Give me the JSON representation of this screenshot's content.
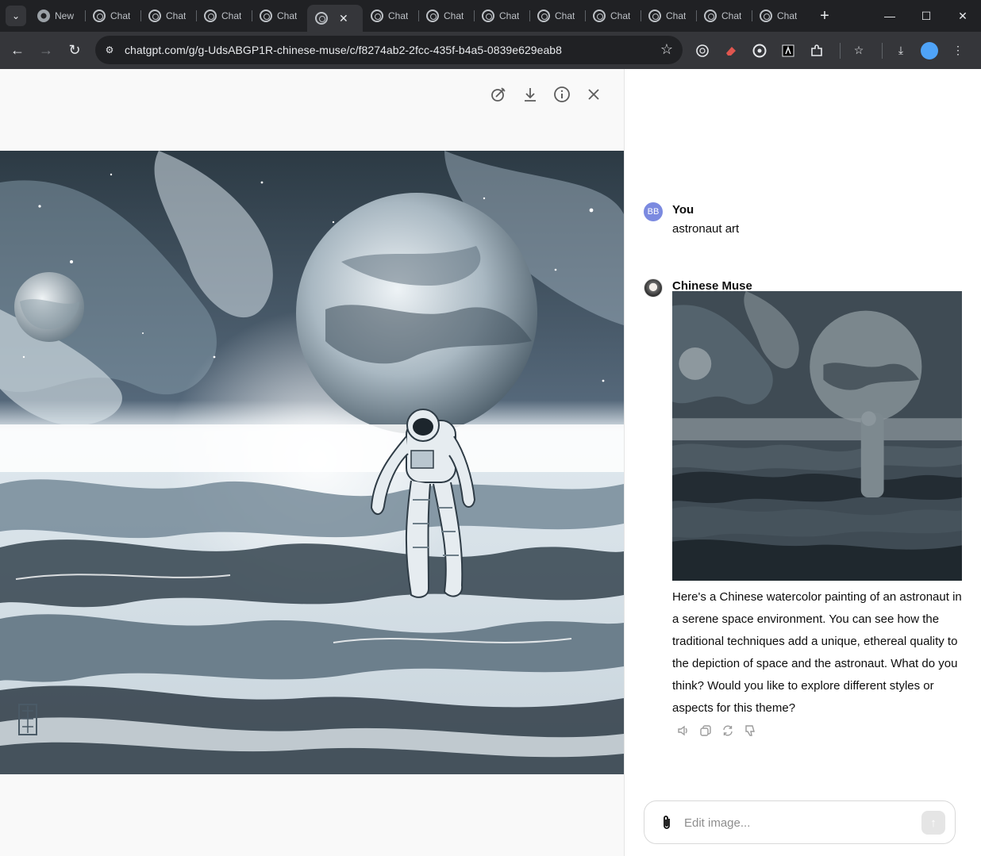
{
  "browser": {
    "tabs": [
      {
        "label": "New",
        "favicon": "chrome-icon",
        "active": false
      },
      {
        "label": "Chat",
        "favicon": "chatgpt-icon",
        "active": false
      },
      {
        "label": "Chat",
        "favicon": "chatgpt-icon",
        "active": false
      },
      {
        "label": "Chat",
        "favicon": "chatgpt-icon",
        "active": false
      },
      {
        "label": "Chat",
        "favicon": "chatgpt-icon",
        "active": false
      },
      {
        "label": "",
        "favicon": "chatgpt-icon",
        "active": true
      },
      {
        "label": "Chat",
        "favicon": "chatgpt-icon",
        "active": false
      },
      {
        "label": "Chat",
        "favicon": "chatgpt-icon",
        "active": false
      },
      {
        "label": "Chat",
        "favicon": "chatgpt-icon",
        "active": false
      },
      {
        "label": "Chat",
        "favicon": "chatgpt-icon",
        "active": false
      },
      {
        "label": "Chat",
        "favicon": "chatgpt-icon",
        "active": false
      },
      {
        "label": "Chat",
        "favicon": "chatgpt-icon",
        "active": false
      },
      {
        "label": "Chat",
        "favicon": "chatgpt-icon",
        "active": false
      },
      {
        "label": "Chat",
        "favicon": "chatgpt-icon",
        "active": false
      }
    ],
    "url": "chatgpt.com/g/g-UdsABGP1R-chinese-muse/c/f8274ab2-2fcc-435f-b4a5-0839e629eab8"
  },
  "viewer": {
    "tools": [
      "edit-selection-icon",
      "download-icon",
      "info-icon",
      "close-icon"
    ]
  },
  "chat": {
    "user": {
      "initials": "BB",
      "name": "You",
      "message": "astronaut art"
    },
    "assistant": {
      "name": "Chinese Muse",
      "reply": "Here's a Chinese watercolor painting of an astronaut in a serene space environment. You can see how the traditional techniques add a unique, ethereal quality to the depiction of space and the astronaut. What do you think? Would you like to explore different styles or aspects for this theme?"
    },
    "composer": {
      "placeholder": "Edit image..."
    }
  },
  "colors": {
    "chrome_dark": "#202124",
    "chrome_toolbar": "#35363a",
    "viewer_bg": "#f9f9f9",
    "user_avatar": "#7b8ae0",
    "ink_dark": "#2e3b45",
    "ink_mid": "#8fa3b0"
  }
}
